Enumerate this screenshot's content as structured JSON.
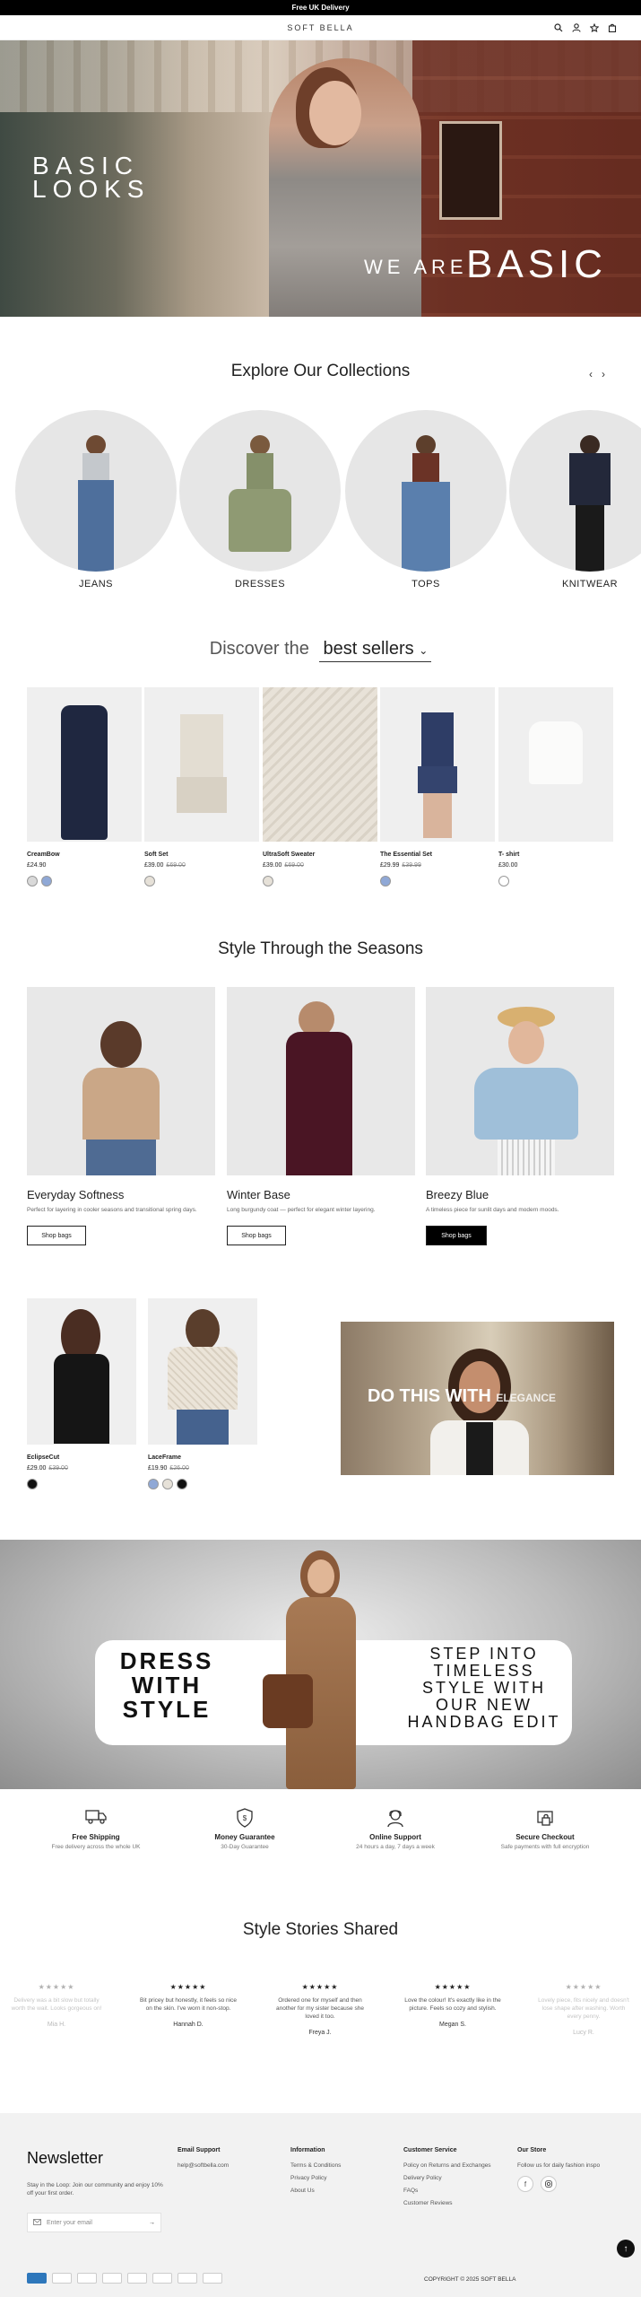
{
  "announcement": "Free UK Delivery",
  "header": {
    "logo": "SOFT BELLA",
    "icons": [
      "search-icon",
      "user-icon",
      "wishlist-icon",
      "cart-icon"
    ]
  },
  "hero": {
    "left_text": "BASIC LOOKS",
    "we_are": "WE ARE",
    "basic": "BASIC"
  },
  "collections": {
    "title": "Explore Our Collections",
    "items": [
      {
        "label": "JEANS"
      },
      {
        "label": "DRESSES"
      },
      {
        "label": "TOPS"
      },
      {
        "label": "KNITWEAR"
      }
    ]
  },
  "bestsellers": {
    "prefix": "Discover the",
    "selected": "best sellers",
    "products": [
      {
        "name": "CreamBow",
        "price": "£24.90",
        "old": "",
        "swatches": [
          "#d9d9d9",
          "#8fa8d6"
        ]
      },
      {
        "name": "Soft Set",
        "price": "£39.00",
        "old": "£69.00",
        "swatches": [
          "#e6e1d8"
        ]
      },
      {
        "name": "UltraSoft Sweater",
        "price": "£39.00",
        "old": "£69.00",
        "swatches": [
          "#e6e1d8"
        ]
      },
      {
        "name": "The Essential Set",
        "price": "£29.99",
        "old": "£39.99",
        "swatches": [
          "#8fa8d6"
        ]
      },
      {
        "name": "T- shirt",
        "price": "£30.00",
        "old": "",
        "swatches": [
          "#ffffff"
        ]
      }
    ]
  },
  "seasons": {
    "title": "Style Through the Seasons",
    "items": [
      {
        "title": "Everyday Softness",
        "desc": "Perfect for layering in cooler seasons and transitional spring days.",
        "button": "Shop bags"
      },
      {
        "title": "Winter Base",
        "desc": "Long burgundy coat — perfect for elegant winter layering.",
        "button": "Shop bags"
      },
      {
        "title": "Breezy Blue",
        "desc": "A timeless piece for sunlit days and modern moods.",
        "button": "Shop bags"
      }
    ]
  },
  "featured": {
    "products": [
      {
        "name": "EclipseCut",
        "price": "£29.00",
        "old": "£39.00",
        "swatches": [
          "#111111"
        ]
      },
      {
        "name": "LaceFrame",
        "price": "£19.90",
        "old": "£26.00",
        "swatches": [
          "#8fa8d6",
          "#e6e1d8",
          "#111111"
        ]
      }
    ],
    "video_text": "DO THIS WITH",
    "video_text_small": "ELEGANCE"
  },
  "banner": {
    "left": [
      "DRESS",
      "WITH",
      "STYLE"
    ],
    "right": [
      "STEP INTO",
      "TIMELESS",
      "STYLE WITH",
      "OUR NEW",
      "HANDBAG EDIT"
    ]
  },
  "features": [
    {
      "icon": "truck-icon",
      "title": "Free Shipping",
      "desc": "Free delivery across the whole UK"
    },
    {
      "icon": "shield-icon",
      "title": "Money Guarantee",
      "desc": "30-Day Guarantee"
    },
    {
      "icon": "support-icon",
      "title": "Online Support",
      "desc": "24 hours a day, 7 days a week"
    },
    {
      "icon": "lock-icon",
      "title": "Secure Checkout",
      "desc": "Safe payments with full encryption"
    }
  ],
  "reviews": {
    "title": "Style Stories Shared",
    "items": [
      {
        "text": "Delivery was a bit slow but totally worth the wait. Looks gorgeous on!",
        "name": "Mia H.",
        "stars": "★★★★★"
      },
      {
        "text": "Bit pricey but honestly, it feels so nice on the skin. I've worn it non-stop.",
        "name": "Hannah D.",
        "stars": "★★★★★"
      },
      {
        "text": "Ordered one for myself and then another for my sister because she loved it too.",
        "name": "Freya J.",
        "stars": "★★★★★"
      },
      {
        "text": "Love the colour! It's exactly like in the picture. Feels so cozy and stylish.",
        "name": "Megan S.",
        "stars": "★★★★★"
      },
      {
        "text": "Lovely piece, fits nicely and doesn't lose shape after washing. Worth every penny.",
        "name": "Lucy R.",
        "stars": "★★★★★"
      }
    ]
  },
  "footer": {
    "newsletter_title": "Newsletter",
    "newsletter_desc": "Stay in the Loop: Join our community and enjoy 10% off your first order.",
    "email_placeholder": "Enter your email",
    "support": {
      "title": "Email Support",
      "links": [
        "help@softbella.com"
      ]
    },
    "information": {
      "title": "Information",
      "links": [
        "Terms & Conditions",
        "Privacy Policy",
        "About Us"
      ]
    },
    "customer_service": {
      "title": "Customer Service",
      "links": [
        "Policy on Returns and Exchanges",
        "Delivery Policy",
        "FAQs",
        "Customer Reviews"
      ]
    },
    "store": {
      "title": "Our Store",
      "desc": "Follow us for daily fashion inspo"
    },
    "payments": [
      "Amex",
      "Apple Pay",
      "Diners",
      "Discover",
      "G Pay",
      "Maestro",
      "Mastercard",
      "Visa"
    ],
    "copyright": "COPYRIGHT © 2025 SOFT BELLA"
  }
}
